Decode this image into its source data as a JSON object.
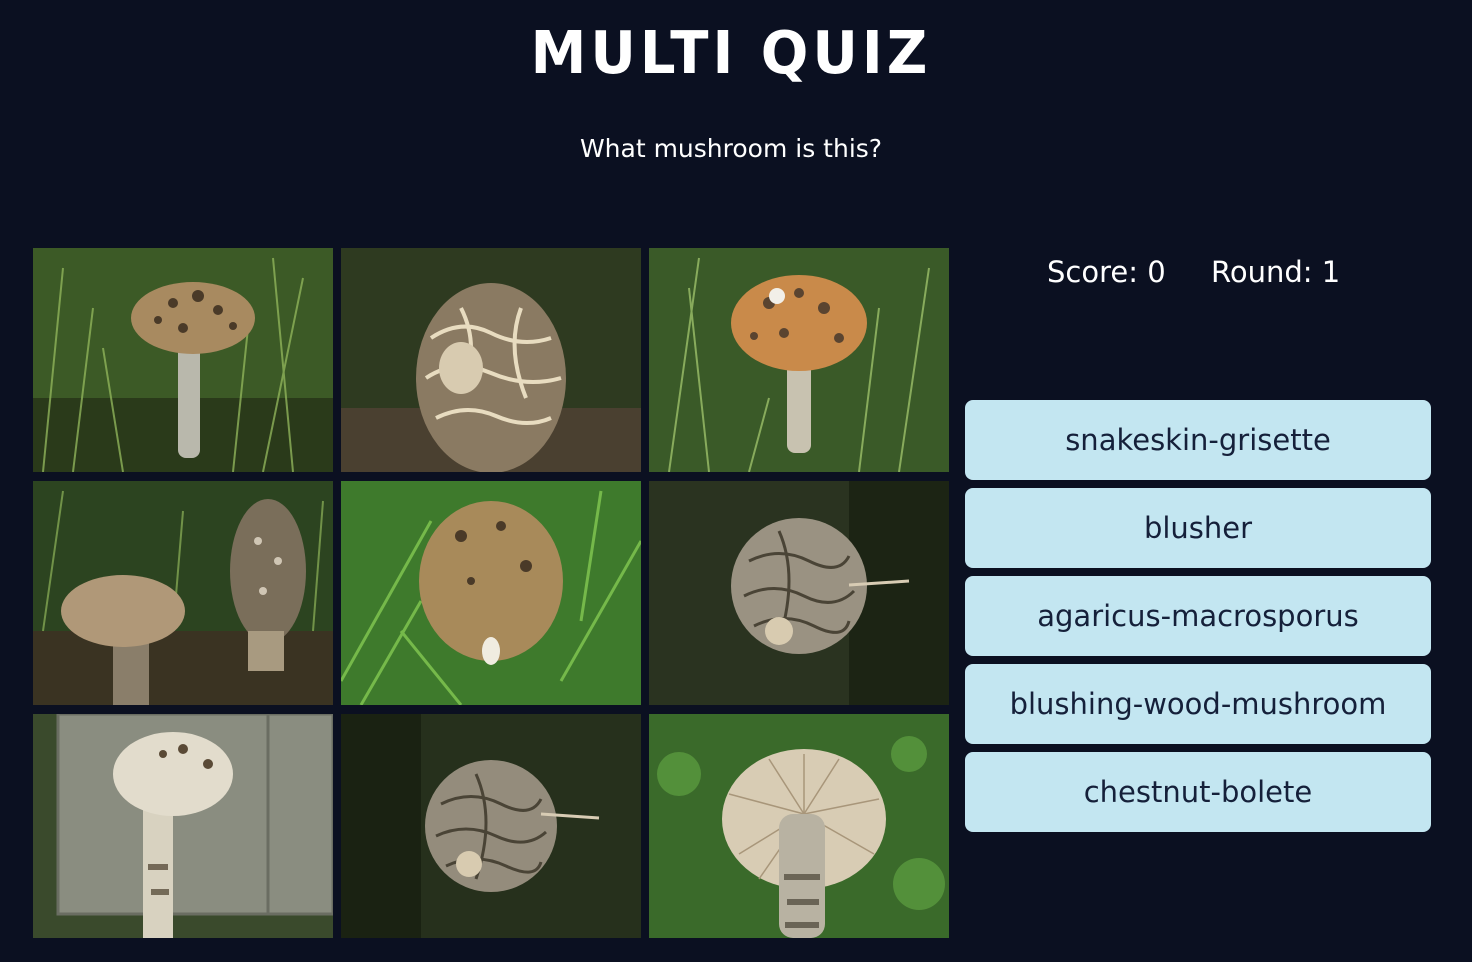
{
  "header": {
    "title": "MULTI QUIZ",
    "question": "What mushroom is this?"
  },
  "stats": {
    "score_text": "Score: 0",
    "round_text": "Round: 1"
  },
  "answers": [
    "snakeskin-grisette",
    "blusher",
    "agaricus-macrosporus",
    "blushing-wood-mushroom",
    "chestnut-bolete"
  ],
  "colors": {
    "background": "#0b1021",
    "answer_button": "#c3e6f1",
    "answer_text": "#15203a"
  }
}
